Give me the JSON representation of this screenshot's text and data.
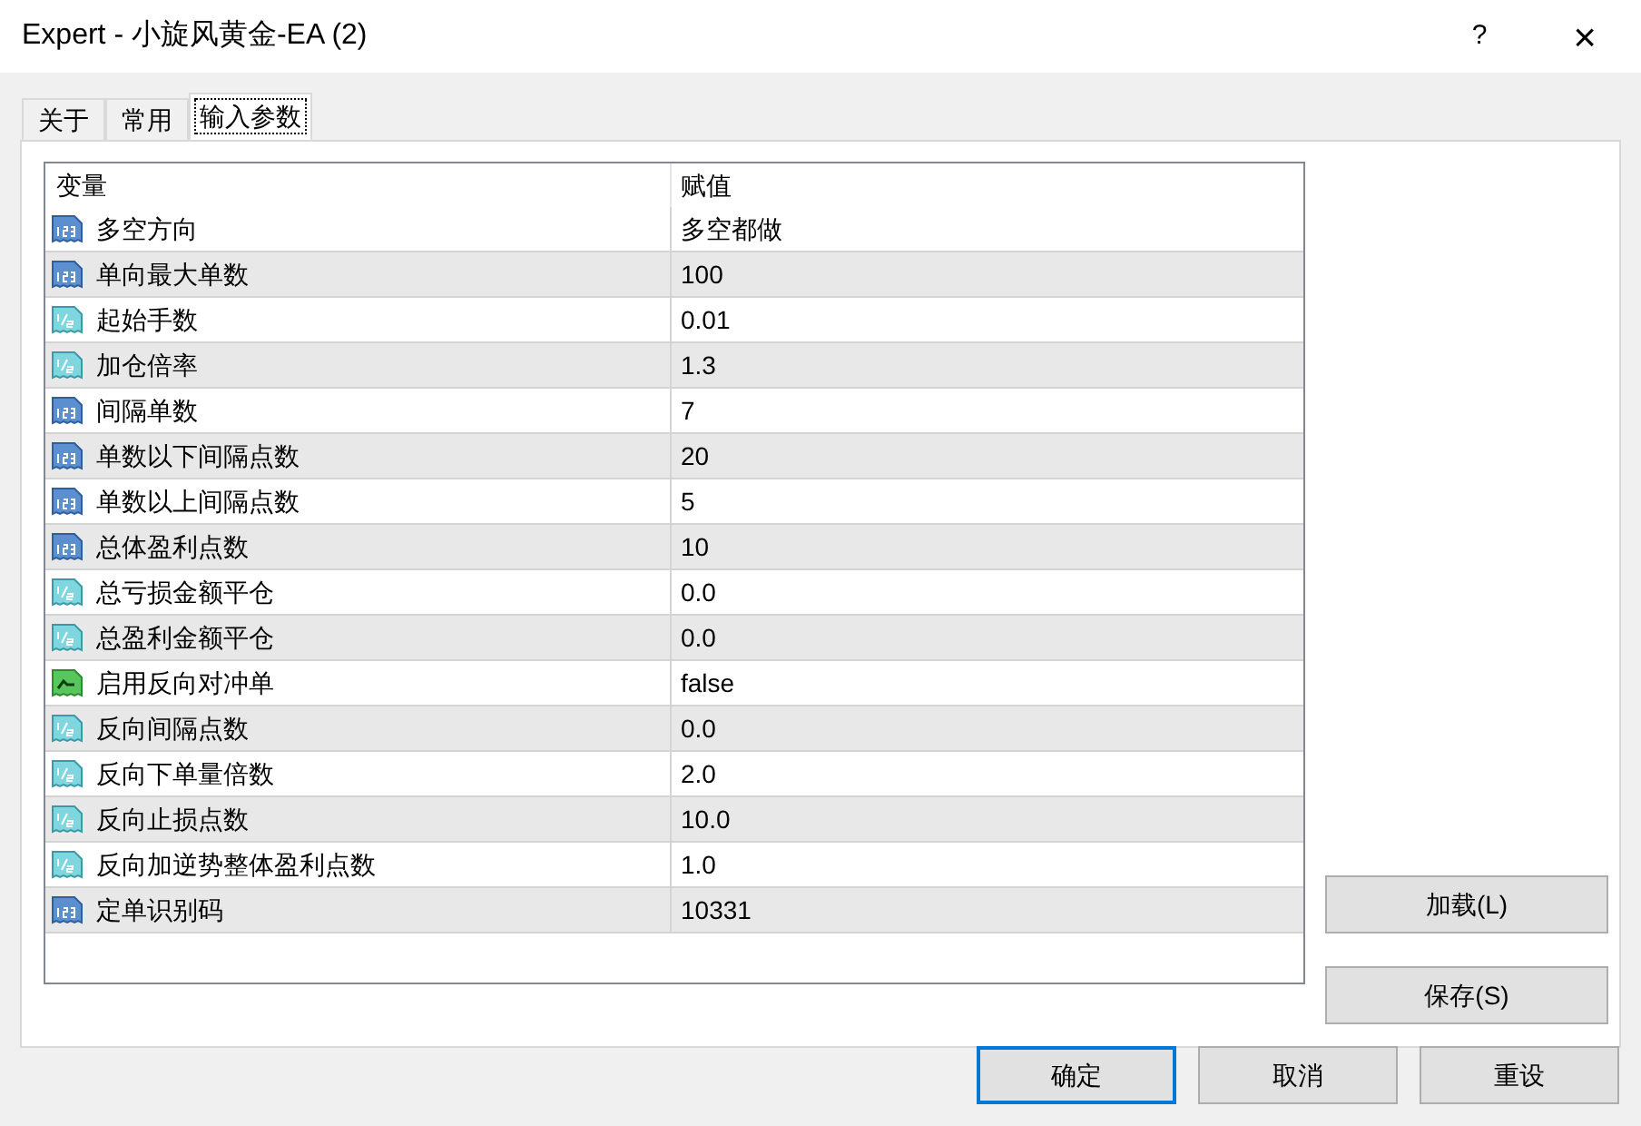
{
  "window": {
    "title": "Expert - 小旋风黄金-EA (2)",
    "help": "?",
    "close": "×"
  },
  "tabs": [
    {
      "label": "关于",
      "selected": false
    },
    {
      "label": "常用",
      "selected": false
    },
    {
      "label": "输入参数",
      "selected": true
    }
  ],
  "table": {
    "columns": [
      "变量",
      "赋值"
    ],
    "rows": [
      {
        "kind": "int",
        "name": "多空方向",
        "value": "多空都做"
      },
      {
        "kind": "int",
        "name": "单向最大单数",
        "value": "100"
      },
      {
        "kind": "double",
        "name": "起始手数",
        "value": "0.01"
      },
      {
        "kind": "double",
        "name": "加仓倍率",
        "value": "1.3"
      },
      {
        "kind": "int",
        "name": "间隔单数",
        "value": "7"
      },
      {
        "kind": "int",
        "name": "单数以下间隔点数",
        "value": "20"
      },
      {
        "kind": "int",
        "name": "单数以上间隔点数",
        "value": "5"
      },
      {
        "kind": "int",
        "name": "总体盈利点数",
        "value": "10"
      },
      {
        "kind": "double",
        "name": "总亏损金额平仓",
        "value": "0.0"
      },
      {
        "kind": "double",
        "name": "总盈利金额平仓",
        "value": "0.0"
      },
      {
        "kind": "bool",
        "name": "启用反向对冲单",
        "value": "false"
      },
      {
        "kind": "double",
        "name": "反向间隔点数",
        "value": "0.0"
      },
      {
        "kind": "double",
        "name": "反向下单量倍数",
        "value": "2.0"
      },
      {
        "kind": "double",
        "name": "反向止损点数",
        "value": "10.0"
      },
      {
        "kind": "double",
        "name": "反向加逆势整体盈利点数",
        "value": "1.0"
      },
      {
        "kind": "int",
        "name": "定单识别码",
        "value": "10331"
      }
    ]
  },
  "side_buttons": [
    "加载(L)",
    "保存(S)"
  ],
  "footer_buttons": [
    {
      "label": "确定",
      "selected": true
    },
    {
      "label": "取消",
      "selected": false
    },
    {
      "label": "重设",
      "selected": false
    }
  ]
}
